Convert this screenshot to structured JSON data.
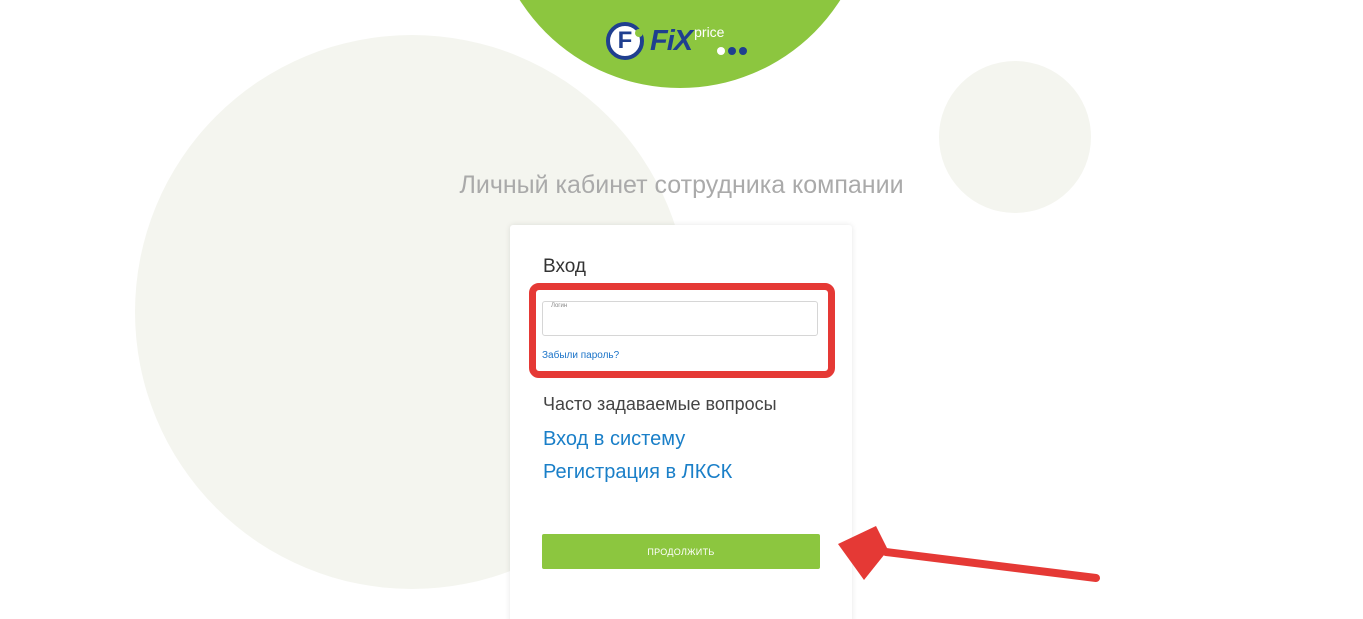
{
  "brand": {
    "logo_letter": "F",
    "logo_fix": "FiX",
    "logo_price": "price",
    "accent_color": "#8cc63f",
    "brand_blue": "#1f3f8f"
  },
  "page": {
    "title": "Личный кабинет сотрудника компании"
  },
  "login_card": {
    "heading": "Вход",
    "login_field": {
      "label": "Логин",
      "value": "",
      "placeholder": ""
    },
    "forgot_password": "Забыли пароль?",
    "faq_title": "Часто задаваемые вопросы",
    "faq_links": [
      "Вход в систему",
      "Регистрация в ЛКСК"
    ],
    "continue_button": "ПРОДОЛЖИТЬ"
  },
  "annotations": {
    "highlight_color": "#e53935",
    "arrow_color": "#e53935"
  }
}
